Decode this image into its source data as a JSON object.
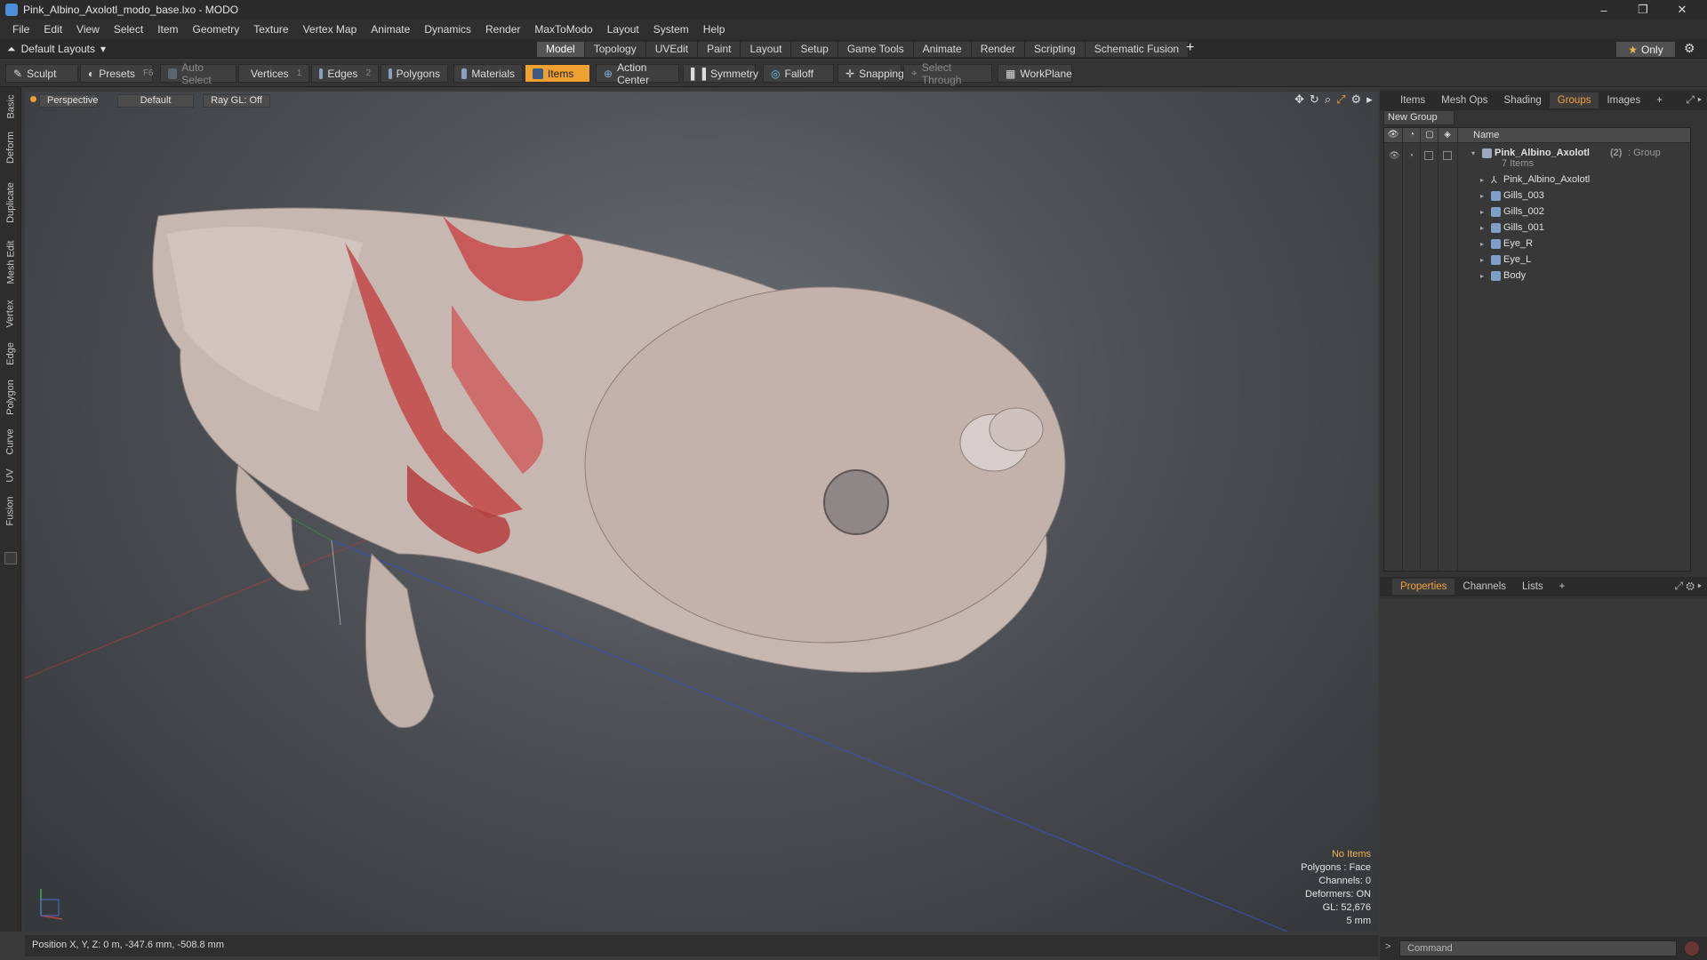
{
  "window": {
    "title": "Pink_Albino_Axolotl_modo_base.lxo - MODO",
    "controls": [
      "–",
      "❐",
      "✕"
    ]
  },
  "menu": [
    "File",
    "Edit",
    "View",
    "Select",
    "Item",
    "Geometry",
    "Texture",
    "Vertex Map",
    "Animate",
    "Dynamics",
    "Render",
    "MaxToModo",
    "Layout",
    "System",
    "Help"
  ],
  "layout_bar": {
    "layouts_label": "Default Layouts",
    "tabs": [
      "Model",
      "Topology",
      "UVEdit",
      "Paint",
      "Layout",
      "Setup",
      "Game Tools",
      "Animate",
      "Render",
      "Scripting",
      "Schematic Fusion"
    ],
    "active_tab": "Model",
    "only_label": "Only"
  },
  "toolbar": {
    "sculpt": "Sculpt",
    "presets": "Presets",
    "presets_key": "F6",
    "auto_select": "Auto Select",
    "vertices": "Vertices",
    "vertices_key": "1",
    "edges": "Edges",
    "edges_key": "2",
    "polygons": "Polygons",
    "materials": "Materials",
    "items": "Items",
    "action_center": "Action Center",
    "symmetry": "Symmetry",
    "falloff": "Falloff",
    "snapping": "Snapping",
    "select_through": "Select Through",
    "workplane": "WorkPlane"
  },
  "left_tabs": [
    "Basic",
    "Deform",
    "Duplicate",
    "Mesh Edit",
    "Vertex",
    "Edge",
    "Polygon",
    "Curve",
    "UV",
    "Fusion"
  ],
  "viewport": {
    "view": "Perspective",
    "shading": "Default",
    "raygl": "Ray GL: Off",
    "stats": {
      "selection": "No Items",
      "polygons": "Polygons : Face",
      "channels": "Channels: 0",
      "deformers": "Deformers: ON",
      "gl": "GL: 52,676",
      "grid": "5 mm"
    }
  },
  "status": {
    "position": "Position X, Y, Z:  0 m, -347.6 mm, -508.8 mm"
  },
  "right_panel": {
    "top_tabs": [
      "Items",
      "Mesh Ops",
      "Shading",
      "Groups",
      "Images"
    ],
    "top_active": "Groups",
    "new_group": "New Group",
    "name_header": "Name",
    "group": {
      "name": "Pink_Albino_Axolotl",
      "count": "(2)",
      "type": ": Group",
      "items_label": "7 Items"
    },
    "children": [
      "Pink_Albino_Axolotl",
      "Gills_003",
      "Gills_002",
      "Gills_001",
      "Eye_R",
      "Eye_L",
      "Body"
    ],
    "bottom_tabs": [
      "Properties",
      "Channels",
      "Lists"
    ],
    "bottom_active": "Properties",
    "command_placeholder": "Command"
  },
  "colors": {
    "accent": "#f0a030",
    "background": "#3a3a3a"
  }
}
